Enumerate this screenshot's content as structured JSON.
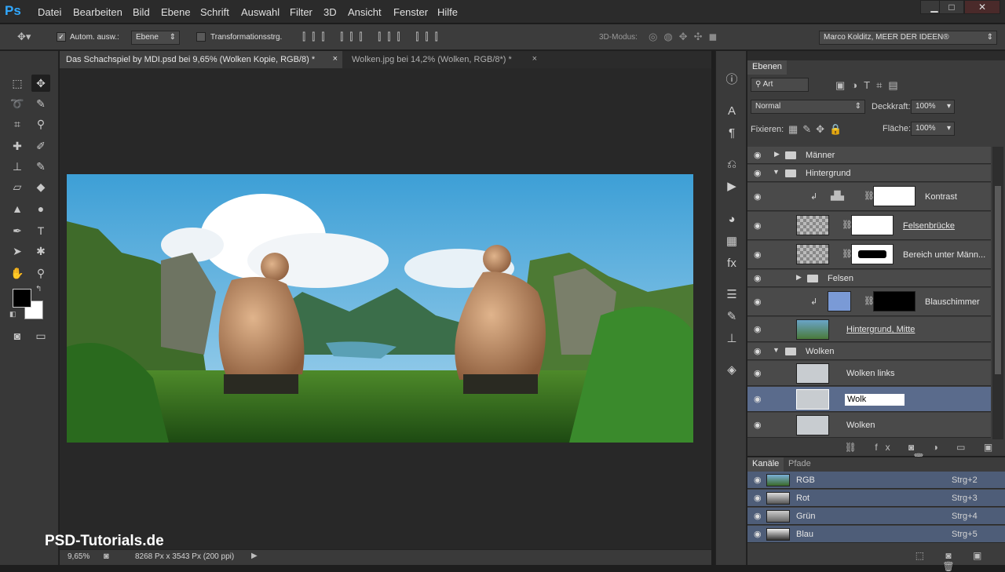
{
  "app": {
    "logo": "Ps"
  },
  "menu": [
    "Datei",
    "Bearbeiten",
    "Bild",
    "Ebene",
    "Schrift",
    "Auswahl",
    "Filter",
    "3D",
    "Ansicht",
    "Fenster",
    "Hilfe"
  ],
  "window_controls": {
    "minimize": "▁",
    "maximize": "□",
    "close": "✕"
  },
  "options": {
    "auto_select_label": "Autom. ausw.:",
    "auto_select_value": "Ebene",
    "transform_label": "Transformationsstrg.",
    "mode_3d_label": "3D-Modus:",
    "workspace": "Marco Kolditz, MEER DER IDEEN®"
  },
  "tabs": [
    {
      "label": "Das Schachspiel by MDI.psd bei 9,65% (Wolken Kopie, RGB/8) *",
      "close": "×"
    },
    {
      "label": "Wolken.jpg bei 14,2% (Wolken, RGB/8*) *",
      "close": "×"
    }
  ],
  "status": {
    "zoom": "9,65%",
    "doc_info": "8268 Px x 3543 Px (200 ppi)"
  },
  "watermark": "PSD-Tutorials.de",
  "layers_panel": {
    "title": "Ebenen",
    "filter_kind": "Art",
    "blend_mode": "Normal",
    "opacity_label": "Deckkraft:",
    "opacity_value": "100%",
    "lock_label": "Fixieren:",
    "fill_label": "Fläche:",
    "fill_value": "100%",
    "layers": [
      {
        "name": "Männer"
      },
      {
        "name": "Hintergrund"
      },
      {
        "name": "Kontrast"
      },
      {
        "name": "Felsenbrücke"
      },
      {
        "name": "Bereich unter Männ..."
      },
      {
        "name": "Felsen"
      },
      {
        "name": "Blauschimmer"
      },
      {
        "name": "Hintergrund, Mitte"
      },
      {
        "name": "Wolken"
      },
      {
        "name": "Wolken links"
      },
      {
        "name": "Wolk"
      },
      {
        "name": "Wolken"
      }
    ]
  },
  "channels_panel": {
    "tab_channels": "Kanäle",
    "tab_paths": "Pfade",
    "channels": [
      {
        "name": "RGB",
        "shortcut": "Strg+2"
      },
      {
        "name": "Rot",
        "shortcut": "Strg+3"
      },
      {
        "name": "Grün",
        "shortcut": "Strg+4"
      },
      {
        "name": "Blau",
        "shortcut": "Strg+5"
      }
    ]
  },
  "colors": {
    "accent": "#31a8ff",
    "selection": "#5a6b8c",
    "panel": "#3c3c3c"
  }
}
